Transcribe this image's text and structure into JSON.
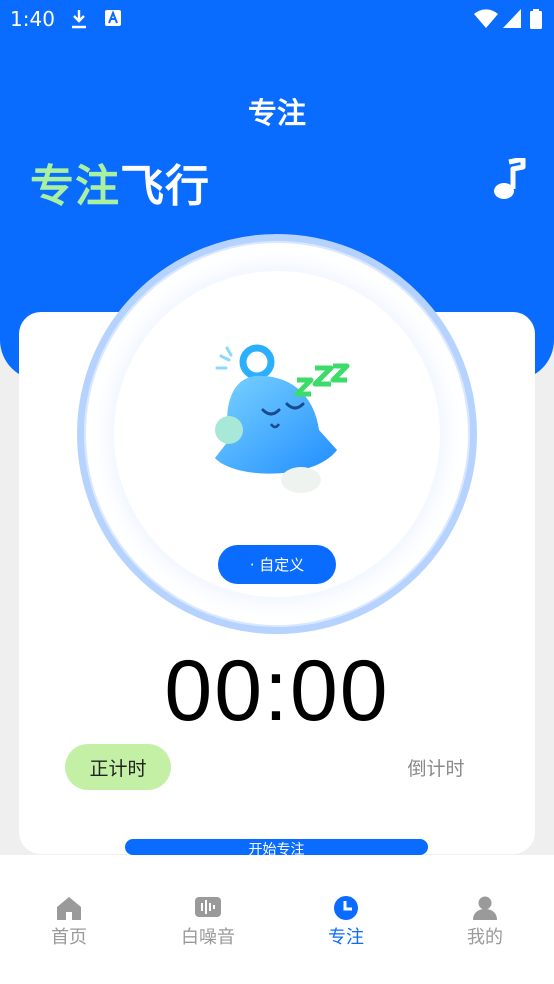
{
  "status_bar": {
    "time": "1:40",
    "icons": [
      "download-icon",
      "keyboard-a-icon",
      "wifi-icon",
      "signal-icon",
      "battery-icon"
    ]
  },
  "header": {
    "title": "专注",
    "brand_part1": "专注",
    "brand_part2": "飞行",
    "music_icon": "music-note-icon"
  },
  "focus": {
    "custom_label": "· 自定义",
    "timer": "00:00",
    "mode_count_up": "正计时",
    "mode_count_down": "倒计时",
    "start_label": "开始专注"
  },
  "tabs": [
    {
      "label": "首页",
      "icon": "home-icon"
    },
    {
      "label": "白噪音",
      "icon": "white-noise-icon"
    },
    {
      "label": "专注",
      "icon": "clock-icon"
    },
    {
      "label": "我的",
      "icon": "user-icon"
    }
  ],
  "colors": {
    "primary": "#0a6bff",
    "accent_green": "#a9f0a0",
    "pill_green": "#c4f0a5"
  }
}
